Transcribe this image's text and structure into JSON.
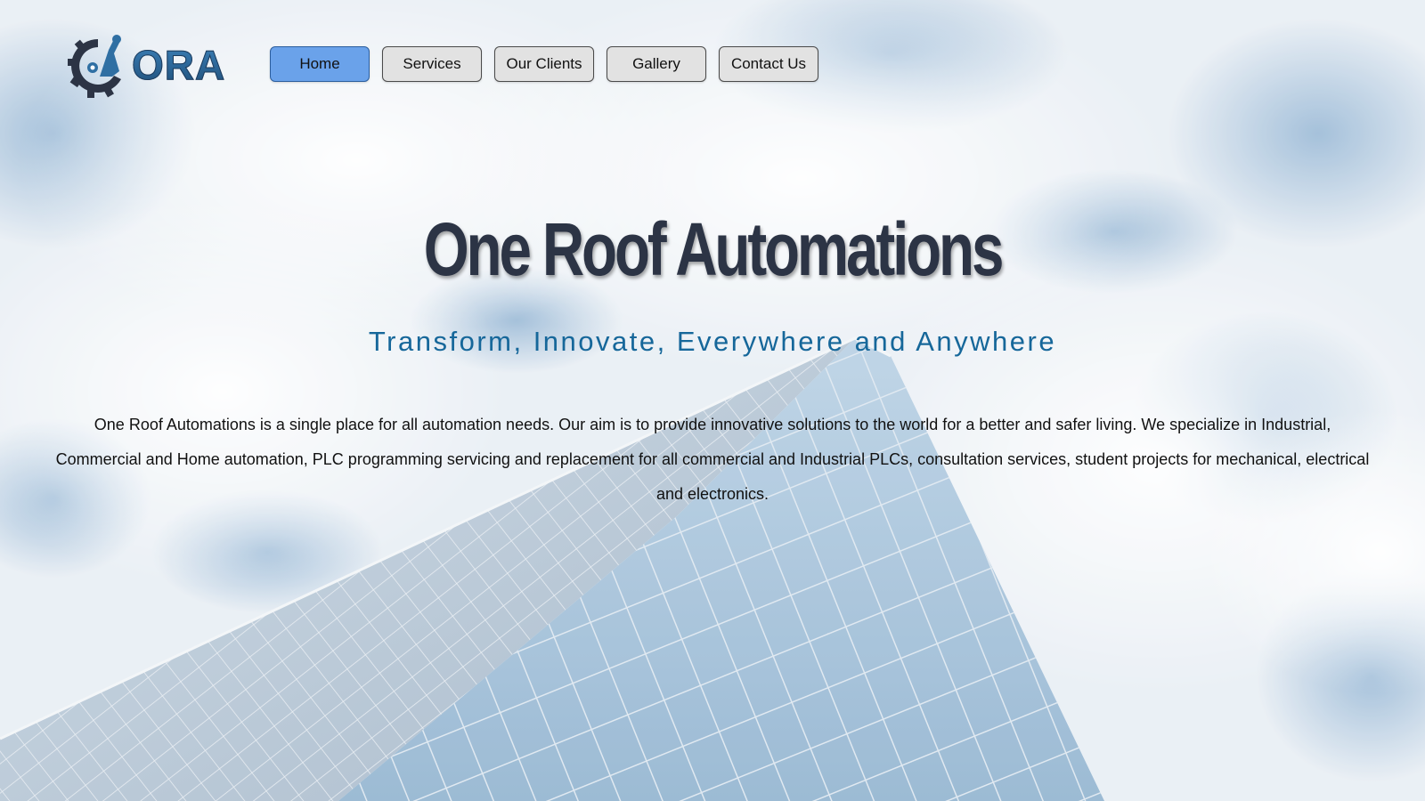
{
  "brand": {
    "logo_text": "ORA",
    "logo_icon": "gear-robot-arm-icon"
  },
  "nav": {
    "items": [
      {
        "label": "Home",
        "active": true
      },
      {
        "label": "Services",
        "active": false
      },
      {
        "label": "Our Clients",
        "active": false
      },
      {
        "label": "Gallery",
        "active": false
      },
      {
        "label": "Contact Us",
        "active": false
      }
    ]
  },
  "hero": {
    "title": "One Roof Automations",
    "tagline": "Transform, Innovate, Everywhere and Anywhere",
    "description": "One Roof Automations is a single place for all automation needs. Our aim is to provide innovative solutions to the world for a better and safer living. We specialize in Industrial, Commercial and Home automation, PLC programming servicing and replacement for all commercial and Industrial PLCs, consultation services, student projects for mechanical, electrical and electronics."
  },
  "colors": {
    "active_nav": "#6aa2ea",
    "nav_bg": "#e2e2e2",
    "title": "#2c3445",
    "tagline": "#16679a"
  }
}
